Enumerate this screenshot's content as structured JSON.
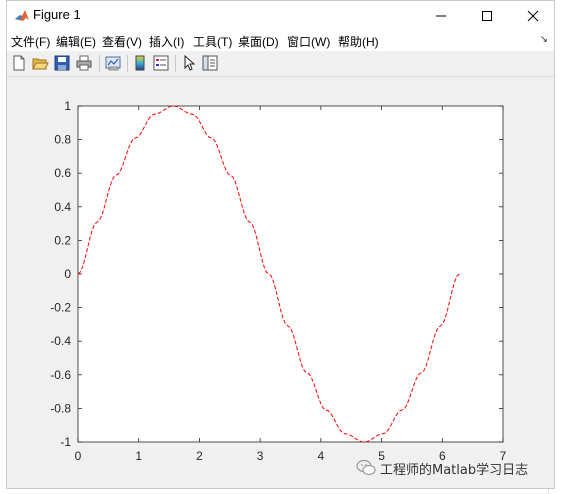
{
  "window": {
    "title": "Figure 1",
    "controls": {
      "minimize": "—",
      "maximize": "☐",
      "close": "✕"
    }
  },
  "menubar": {
    "items": [
      "文件(F)",
      "编辑(E)",
      "查看(V)",
      "插入(I)",
      "工具(T)",
      "桌面(D)",
      "窗口(W)",
      "帮助(H)"
    ],
    "overflow_arrow": "↘"
  },
  "toolbar": {
    "buttons": [
      "new-figure-icon",
      "open-file-icon",
      "save-icon",
      "print-icon",
      "link-plot-icon",
      "insert-colorbar-icon",
      "insert-legend-icon",
      "edit-plot-pointer-icon",
      "property-inspector-icon"
    ]
  },
  "chart_data": {
    "type": "line",
    "title": "",
    "xlabel": "",
    "ylabel": "",
    "xlim": [
      0,
      7
    ],
    "ylim": [
      -1,
      1
    ],
    "xticks": [
      "0",
      "1",
      "2",
      "3",
      "4",
      "5",
      "6",
      "7"
    ],
    "yticks": [
      "-1",
      "-0.8",
      "-0.6",
      "-0.4",
      "-0.2",
      "0",
      "0.2",
      "0.4",
      "0.6",
      "0.8",
      "1"
    ],
    "grid": false,
    "series": [
      {
        "color": "#ff0000",
        "line_style": "dashed",
        "x": [
          0.0,
          0.3142,
          0.6283,
          0.9425,
          1.2566,
          1.5708,
          1.885,
          2.1991,
          2.5133,
          2.8274,
          3.1416,
          3.4558,
          3.7699,
          4.0841,
          4.3982,
          4.7124,
          5.0265,
          5.3407,
          5.6549,
          5.969,
          6.2832
        ],
        "y": [
          0.0,
          0.309,
          0.5878,
          0.809,
          0.9511,
          1.0,
          0.9511,
          0.809,
          0.5878,
          0.309,
          0.0,
          -0.309,
          -0.5878,
          -0.809,
          -0.9511,
          -1.0,
          -0.9511,
          -0.809,
          -0.5878,
          -0.309,
          0.0
        ]
      }
    ]
  },
  "watermark": {
    "text": "工程师的Matlab学习日志",
    "icon": "wechat-icon"
  }
}
